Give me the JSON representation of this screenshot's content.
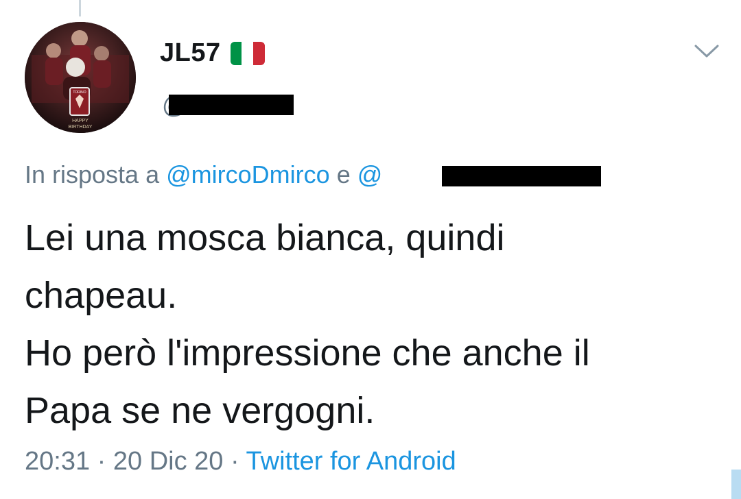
{
  "tweet": {
    "display_name": "JL57",
    "flag_icon": "italy-flag-icon",
    "flag_colors": [
      "#009246",
      "#ffffff",
      "#ce2b37"
    ],
    "handle_prefix": "@",
    "avatar_badge_text": "TORINO",
    "avatar_caption_line1": "HAPPY",
    "avatar_caption_line2": "BIRTHDAY",
    "reply_prefix": "In risposta a",
    "reply_mention": "@mircoDmirco",
    "reply_conjunction": "e",
    "reply_mention2_prefix": "@",
    "text_lines": [
      "Lei una mosca bianca, quindi",
      "chapeau.",
      "Ho però l'impressione che anche il",
      "Papa se ne vergogni."
    ],
    "time": "20:31",
    "date": "20 Dic 20",
    "separator": "·",
    "source": "Twitter for Android"
  },
  "icons": {
    "menu": "chevron-down-icon"
  },
  "colors": {
    "link": "#1b95e0",
    "secondary": "#657786",
    "text": "#14171a"
  }
}
